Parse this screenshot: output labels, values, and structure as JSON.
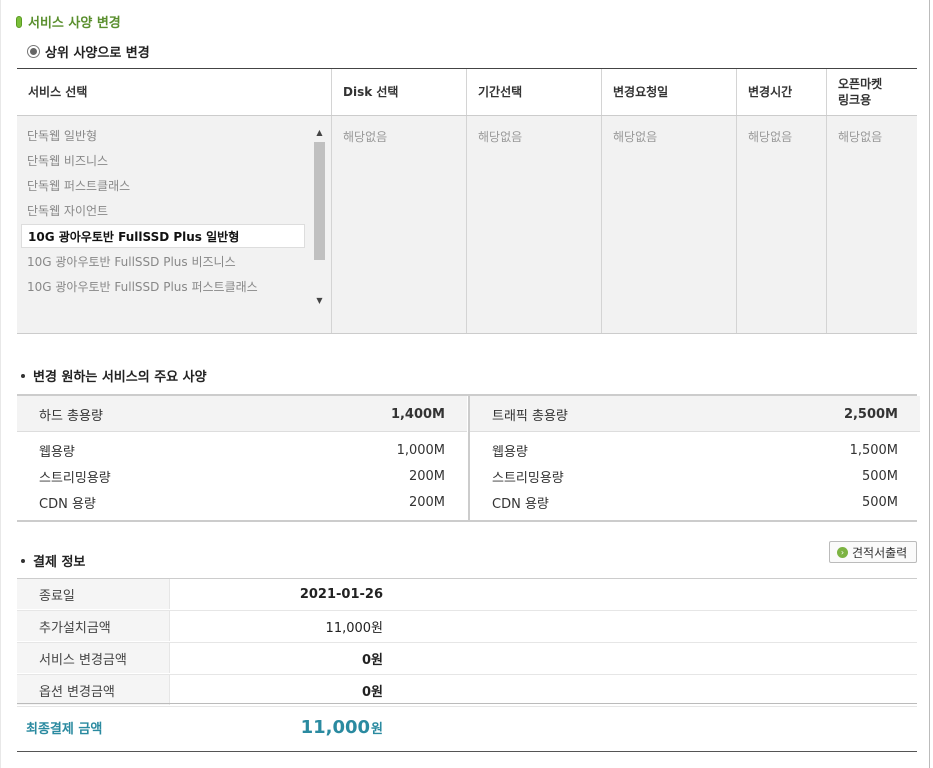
{
  "section_title": "서비스 사양 변경",
  "upgrade_option": "상위 사양으로 변경",
  "service_table": {
    "headers": [
      "서비스 선택",
      "Disk 선택",
      "기간선택",
      "변경요청일",
      "변경시간",
      "오픈마켓\n링크용"
    ],
    "services": [
      "단독웹 일반형",
      "단독웹 비즈니스",
      "단독웹 퍼스트클래스",
      "단독웹 자이언트",
      "10G 광아우토반 FullSSD Plus 일반형",
      "10G 광아우토반 FullSSD Plus 비즈니스",
      "10G 광아우토반 FullSSD Plus 퍼스트클래스"
    ],
    "selected_service": "10G 광아우토반 FullSSD Plus 일반형",
    "na_text": "해당없음"
  },
  "spec_section": {
    "title": "변경 원하는 서비스의 주요 사양",
    "left": {
      "head_label": "하드 총용량",
      "head_value": "1,400M",
      "rows": [
        {
          "label": "웹용량",
          "value": "1,000M"
        },
        {
          "label": "스트리밍용량",
          "value": "200M"
        },
        {
          "label": "CDN 용량",
          "value": "200M"
        }
      ]
    },
    "right": {
      "head_label": "트래픽 총용량",
      "head_value": "2,500M",
      "rows": [
        {
          "label": "웹용량",
          "value": "1,500M"
        },
        {
          "label": "스트리밍용량",
          "value": "500M"
        },
        {
          "label": "CDN 용량",
          "value": "500M"
        }
      ]
    }
  },
  "payment": {
    "title": "결제 정보",
    "estimate_button": "견적서출력",
    "rows": [
      {
        "label": "종료일",
        "value": "2021-01-26"
      },
      {
        "label": "추가설치금액",
        "value": "11,000원"
      },
      {
        "label": "서비스 변경금액",
        "value": "0원"
      },
      {
        "label": "옵션 변경금액",
        "value": "0원"
      }
    ],
    "final_label": "최종결제 금액",
    "final_amount": "11,000",
    "final_unit": "원"
  },
  "colors": {
    "accent_green": "#5a8f2e",
    "accent_teal": "#2a8aa0"
  }
}
